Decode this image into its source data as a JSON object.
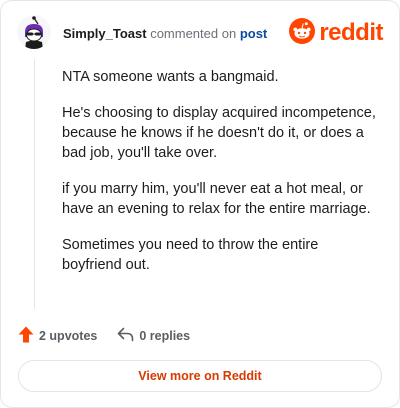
{
  "header": {
    "username": "Simply_Toast",
    "action_text": "commented on",
    "post_link": "post",
    "brand": "reddit"
  },
  "comment": {
    "paragraphs": [
      "NTA someone wants a bangmaid.",
      "He's choosing to display acquired incompetence, because he knows if he doesn't do it, or does a bad job, you'll take over.",
      "if you marry him, you'll never eat a hot meal, or have an evening to relax for the entire marriage.",
      "Sometimes you need to throw the entire boyfriend out."
    ]
  },
  "footer": {
    "upvotes": "2 upvotes",
    "replies": "0 replies",
    "view_more": "View more on Reddit"
  },
  "colors": {
    "brand": "#ff4500",
    "link": "#0a4b9c",
    "view_more": "#d93a00",
    "upvote_icon": "#ff4500"
  },
  "icons": {
    "avatar": "snoo-avatar-icon",
    "brand": "reddit-logo-icon",
    "upvote": "upvote-arrow-icon",
    "reply": "reply-arrow-icon"
  }
}
